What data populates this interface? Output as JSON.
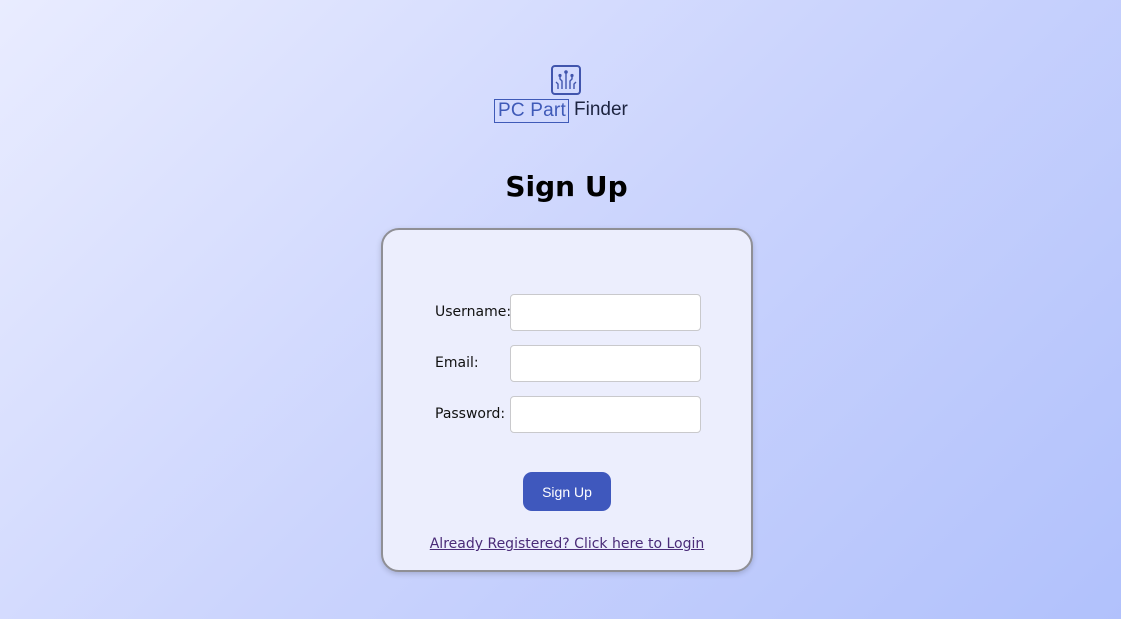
{
  "logo": {
    "pc_part": "PC Part",
    "finder": "Finder",
    "icon": "circuit-chip-icon"
  },
  "page": {
    "title": "Sign Up"
  },
  "form": {
    "username_label": "Username:",
    "email_label": "Email:",
    "password_label": "Password:",
    "username_value": "",
    "email_value": "",
    "password_value": "",
    "submit_label": "Sign Up",
    "login_link": "Already Registered? Click here to Login"
  },
  "colors": {
    "accent": "#3f58bd",
    "card_background": "#eceefd",
    "link": "#4a2b78"
  }
}
